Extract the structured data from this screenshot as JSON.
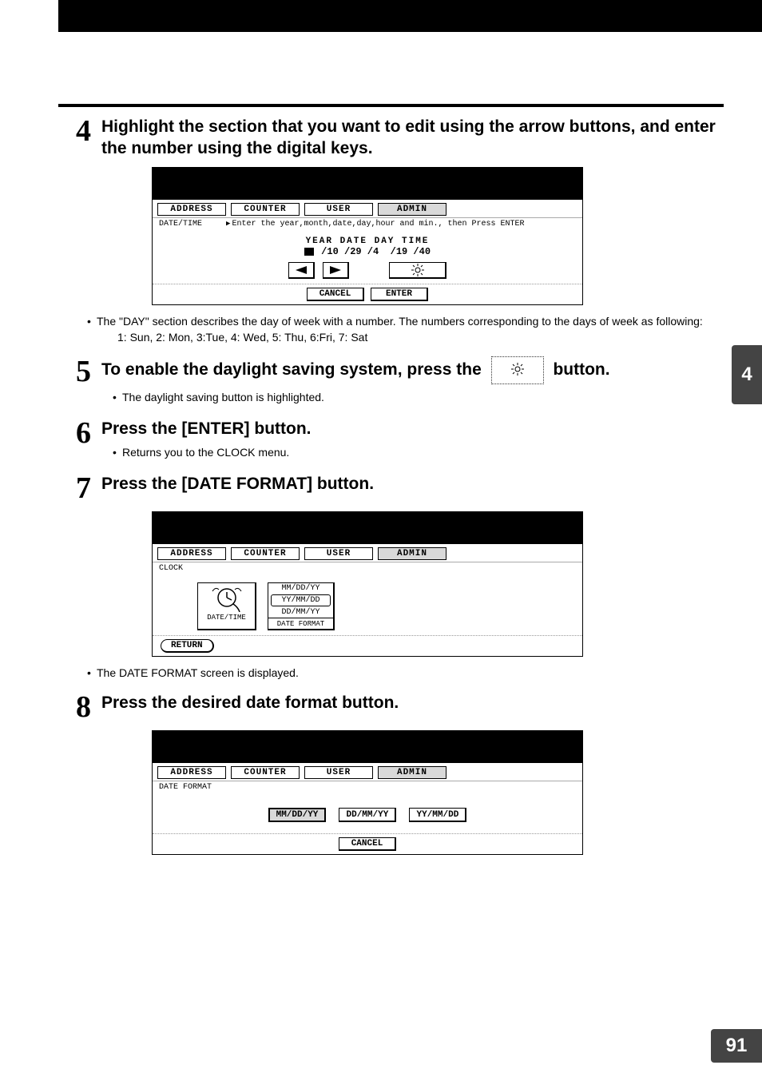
{
  "chapter_tab": "4",
  "page_number": "91",
  "nav_tabs": {
    "address": "ADDRESS",
    "counter": "COUNTER",
    "user": "USER",
    "admin": "ADMIN"
  },
  "device_buttons": {
    "cancel": "CANCEL",
    "enter": "ENTER",
    "return": "RETURN"
  },
  "step4": {
    "num": "4",
    "title": "Highlight the section that you want to edit using the arrow buttons, and enter the number using the digital keys.",
    "screen_label": "DATE/TIME",
    "hint": "Enter the year,month,date,day,hour and min., then Press ENTER",
    "headers": "YEAR  DATE  DAY  TIME",
    "values_prefix": "",
    "y": "10",
    "mo": "29",
    "d": "4",
    "h": "19",
    "mi": "40",
    "bullet1": "The \"DAY\" section describes the day of week with a number.  The numbers corresponding to the days of week as following:",
    "bullet1_sub": "1: Sun, 2: Mon, 3:Tue, 4: Wed, 5: Thu, 6:Fri, 7: Sat"
  },
  "step5": {
    "num": "5",
    "title_before": "To enable the daylight saving system, press the ",
    "title_after": " button.",
    "bullet": "The daylight saving button is highlighted."
  },
  "step6": {
    "num": "6",
    "title": "Press the [ENTER] button.",
    "bullet": "Returns you to the CLOCK menu."
  },
  "step7": {
    "num": "7",
    "title": "Press the [DATE FORMAT] button.",
    "screen_label": "CLOCK",
    "icon_label": "DATE/TIME",
    "fmt_opt1": "MM/DD/YY",
    "fmt_opt2": "YY/MM/DD",
    "fmt_opt3": "DD/MM/YY",
    "fmt_label": "DATE FORMAT",
    "bullet": "The DATE FORMAT screen is displayed."
  },
  "step8": {
    "num": "8",
    "title": "Press the desired date format button.",
    "screen_label": "DATE FORMAT",
    "b1": "MM/DD/YY",
    "b2": "DD/MM/YY",
    "b3": "YY/MM/DD"
  }
}
